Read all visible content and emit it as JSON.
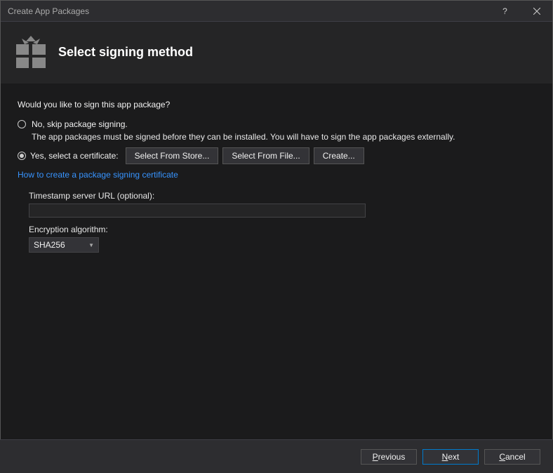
{
  "titlebar": {
    "title": "Create App Packages",
    "help_tooltip": "?",
    "close_tooltip": "×"
  },
  "header": {
    "title": "Select signing method"
  },
  "prompt": "Would you like to sign this app package?",
  "options": {
    "skip": {
      "label": "No, skip package signing.",
      "description": "The app packages must be signed before they can be installed. You will have to sign the app packages externally.",
      "selected": false
    },
    "cert": {
      "label": "Yes, select a certificate:",
      "selected": true,
      "buttons": {
        "store": "Select From Store...",
        "file": "Select From File...",
        "create": "Create..."
      }
    }
  },
  "link": "How to create a package signing certificate",
  "timestamp": {
    "label": "Timestamp server URL (optional):",
    "value": ""
  },
  "encryption": {
    "label": "Encryption algorithm:",
    "value": "SHA256"
  },
  "footer": {
    "previous": "Previous",
    "next": "Next",
    "cancel": "Cancel"
  }
}
